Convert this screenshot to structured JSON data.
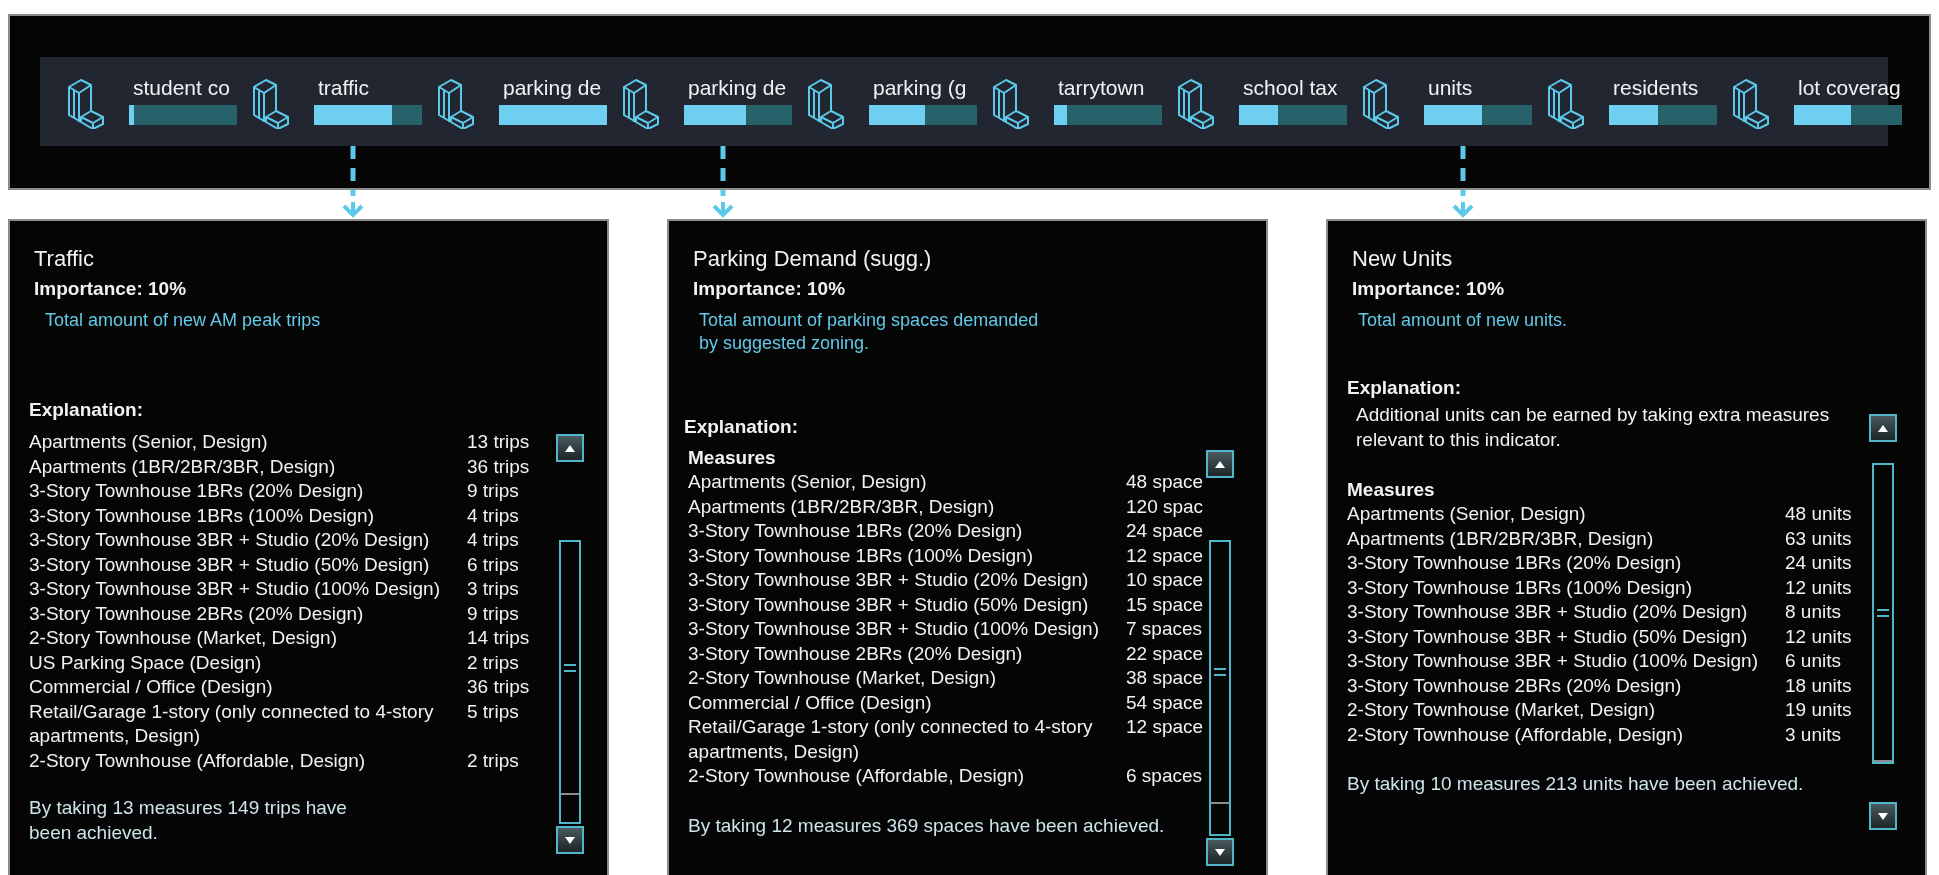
{
  "indicator_bar": {
    "items": [
      {
        "label": "student co",
        "level": 0.05,
        "expanded": false
      },
      {
        "label": "traffic",
        "level": 0.72,
        "expanded": true
      },
      {
        "label": "parking de",
        "level": 1.0,
        "expanded": false
      },
      {
        "label": "parking de",
        "level": 0.57,
        "expanded": true
      },
      {
        "label": "parking (g",
        "level": 0.52,
        "expanded": false
      },
      {
        "label": "tarrytown",
        "level": 0.12,
        "expanded": false
      },
      {
        "label": "school tax",
        "level": 0.36,
        "expanded": false
      },
      {
        "label": "units",
        "level": 0.54,
        "expanded": true
      },
      {
        "label": "residents",
        "level": 0.45,
        "expanded": false
      },
      {
        "label": "lot coverag",
        "level": 0.53,
        "expanded": false
      }
    ]
  },
  "panels": [
    {
      "title": "Traffic",
      "importance": "Importance: 10%",
      "description": "Total amount of new AM peak trips",
      "explanation_heading": "Explanation:",
      "rows": [
        {
          "measure": "Apartments (Senior, Design)",
          "value": "13 trips"
        },
        {
          "measure": "Apartments (1BR/2BR/3BR, Design)",
          "value": "36 trips"
        },
        {
          "measure": "3-Story Townhouse 1BRs (20% Design)",
          "value": "9 trips"
        },
        {
          "measure": "3-Story Townhouse 1BRs (100% Design)",
          "value": "4 trips"
        },
        {
          "measure": "3-Story Townhouse 3BR + Studio (20% Design)",
          "value": "4 trips"
        },
        {
          "measure": "3-Story Townhouse 3BR + Studio (50% Design)",
          "value": "6 trips"
        },
        {
          "measure": "3-Story Townhouse 3BR + Studio (100% Design)",
          "value": "3 trips"
        },
        {
          "measure": "3-Story Townhouse 2BRs (20% Design)",
          "value": "9 trips"
        },
        {
          "measure": "2-Story Townhouse (Market, Design)",
          "value": "14 trips"
        },
        {
          "measure": "US Parking Space (Design)",
          "value": "2 trips"
        },
        {
          "measure": "Commercial / Office (Design)",
          "value": "36 trips"
        },
        {
          "measure": "Retail/Garage 1-story (only connected to 4-story apartments, Design)",
          "value": "5 trips"
        },
        {
          "measure": "2-Story Townhouse (Affordable, Design)",
          "value": "2 trips"
        }
      ],
      "summary": "By taking 13 measures 149 trips have been achieved."
    },
    {
      "title": "Parking Demand (sugg.)",
      "importance": "Importance: 10%",
      "description": "Total amount of parking spaces demanded by suggested zoning.",
      "explanation_heading": "Explanation:",
      "measures_heading": "Measures",
      "rows": [
        {
          "measure": "Apartments (Senior, Design)",
          "value": "48 space"
        },
        {
          "measure": "Apartments (1BR/2BR/3BR, Design)",
          "value": "120 spac"
        },
        {
          "measure": "3-Story Townhouse 1BRs (20% Design)",
          "value": "24 space"
        },
        {
          "measure": "3-Story Townhouse 1BRs (100% Design)",
          "value": "12 space"
        },
        {
          "measure": "3-Story Townhouse 3BR + Studio (20% Design)",
          "value": "10 space"
        },
        {
          "measure": "3-Story Townhouse 3BR + Studio (50% Design)",
          "value": "15 space"
        },
        {
          "measure": "3-Story Townhouse 3BR + Studio (100% Design)",
          "value": "7 spaces"
        },
        {
          "measure": "3-Story Townhouse 2BRs (20% Design)",
          "value": "22 space"
        },
        {
          "measure": "2-Story Townhouse (Market, Design)",
          "value": "38 space"
        },
        {
          "measure": "Commercial / Office (Design)",
          "value": "54 space"
        },
        {
          "measure": "Retail/Garage 1-story (only connected to 4-story apartments, Design)",
          "value": "12 space"
        },
        {
          "measure": "2-Story Townhouse (Affordable, Design)",
          "value": "6 spaces"
        }
      ],
      "summary": "By taking 12 measures 369 spaces have been achieved."
    },
    {
      "title": "New Units",
      "importance": "Importance: 10%",
      "description": "Total amount of new units.",
      "explanation_heading": "Explanation:",
      "explanation_note": "Additional units can be earned by taking extra measures relevant to this indicator.",
      "measures_heading": "Measures",
      "rows": [
        {
          "measure": "Apartments (Senior, Design)",
          "value": "48 units"
        },
        {
          "measure": "Apartments (1BR/2BR/3BR, Design)",
          "value": "63 units"
        },
        {
          "measure": "3-Story Townhouse 1BRs (20% Design)",
          "value": "24 units"
        },
        {
          "measure": "3-Story Townhouse 1BRs (100% Design)",
          "value": "12 units"
        },
        {
          "measure": "3-Story Townhouse 3BR + Studio (20% Design)",
          "value": "8 units"
        },
        {
          "measure": "3-Story Townhouse 3BR + Studio (50% Design)",
          "value": "12 units"
        },
        {
          "measure": "3-Story Townhouse 3BR + Studio (100% Design)",
          "value": "6 units"
        },
        {
          "measure": "3-Story Townhouse 2BRs (20% Design)",
          "value": "18 units"
        },
        {
          "measure": "2-Story Townhouse (Market, Design)",
          "value": "19 units"
        },
        {
          "measure": "2-Story Townhouse (Affordable, Design)",
          "value": "3 units"
        }
      ],
      "summary": "By taking 10 measures 213 units have been achieved."
    }
  ]
}
